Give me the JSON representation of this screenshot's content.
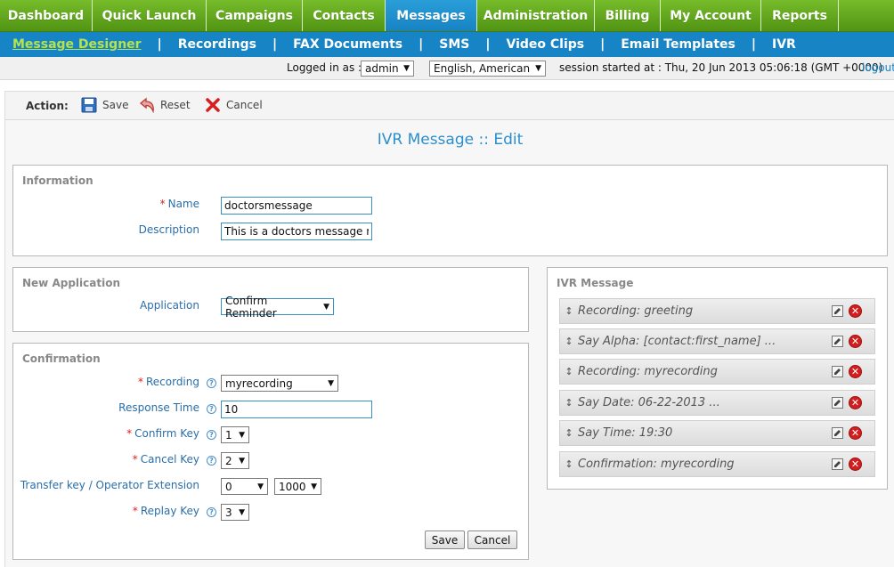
{
  "main_nav": [
    {
      "label": "Dashboard",
      "active": false
    },
    {
      "label": "Quick Launch",
      "active": false
    },
    {
      "label": "Campaigns",
      "active": false
    },
    {
      "label": "Contacts",
      "active": false
    },
    {
      "label": "Messages",
      "active": true
    },
    {
      "label": "Administration",
      "active": false
    },
    {
      "label": "Billing",
      "active": false
    },
    {
      "label": "My Account",
      "active": false
    },
    {
      "label": "Reports",
      "active": false
    }
  ],
  "sub_nav": [
    {
      "label": "Message Designer",
      "active": true
    },
    {
      "label": "Recordings",
      "active": false
    },
    {
      "label": "FAX Documents",
      "active": false
    },
    {
      "label": "SMS",
      "active": false
    },
    {
      "label": "Video Clips",
      "active": false
    },
    {
      "label": "Email Templates",
      "active": false
    },
    {
      "label": "IVR",
      "active": false
    }
  ],
  "status": {
    "logged_in_label": "Logged in as :",
    "user": "admin",
    "language": "English, American",
    "session": "session started at : Thu, 20 Jun 2013 05:06:18 (GMT +0000)",
    "logout": "logout"
  },
  "actions": {
    "label": "Action:",
    "save": "Save",
    "reset": "Reset",
    "cancel": "Cancel"
  },
  "page_title": "IVR Message :: Edit",
  "information": {
    "title": "Information",
    "name_label": "Name",
    "name_value": "doctorsmessage",
    "description_label": "Description",
    "description_value": "This is a doctors message re"
  },
  "new_application": {
    "title": "New Application",
    "application_label": "Application",
    "application_value": "Confirm Reminder"
  },
  "confirmation": {
    "title": "Confirmation",
    "recording_label": "Recording",
    "recording_value": "myrecording",
    "response_time_label": "Response Time",
    "response_time_value": "10",
    "confirm_key_label": "Confirm Key",
    "confirm_key_value": "1",
    "cancel_key_label": "Cancel Key",
    "cancel_key_value": "2",
    "transfer_label": "Transfer key / Operator Extension",
    "transfer_key_value": "0",
    "operator_ext_value": "1000",
    "replay_key_label": "Replay Key",
    "replay_key_value": "3",
    "save_button": "Save",
    "cancel_button": "Cancel"
  },
  "ivr_message": {
    "title": "IVR Message",
    "items": [
      {
        "text": "Recording: greeting"
      },
      {
        "text": "Say Alpha: [contact:first_name] ..."
      },
      {
        "text": "Recording: myrecording"
      },
      {
        "text": "Say Date: 06-22-2013 ..."
      },
      {
        "text": "Say Time: 19:30"
      },
      {
        "text": "Confirmation: myrecording"
      }
    ]
  },
  "colors": {
    "nav_green": "#5fa31c",
    "nav_active_blue": "#1f8fd0",
    "subnav_blue": "#1784c5",
    "subnav_active": "#b6e34b",
    "title_blue": "#2a8fcd",
    "required_red": "#d22222"
  }
}
